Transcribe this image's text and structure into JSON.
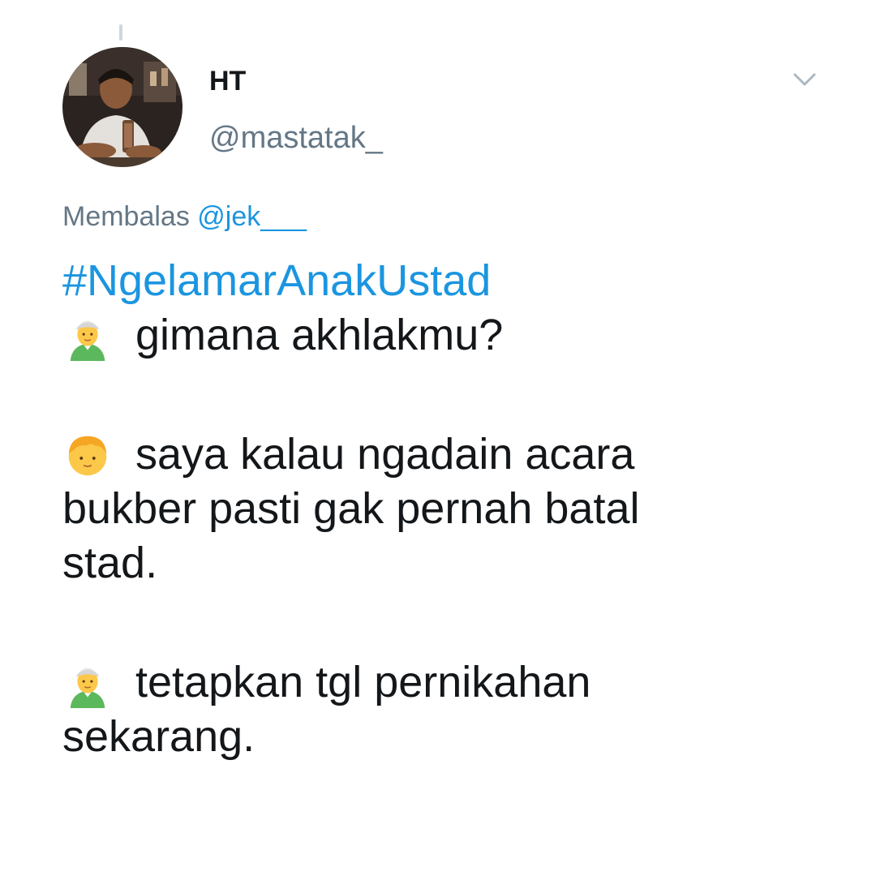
{
  "tweet": {
    "author": {
      "display_name": "HT",
      "handle": "@mastatak_"
    },
    "reply_to": {
      "prefix": "Membalas",
      "mention": "@jek___"
    },
    "hashtag": "#NgelamarAnakUstad",
    "lines": {
      "l1": "gimana akhlakmu?",
      "l2a": "saya kalau ngadain acara",
      "l2b": "bukber pasti gak pernah batal",
      "l2c": "stad.",
      "l3a": "tetapkan tgl pernikahan",
      "l3b": "sekarang."
    },
    "icons": {
      "more": "chevron-down-icon",
      "speaker_ustad": "man-with-turban-emoji",
      "speaker_suitor": "boy-face-emoji"
    }
  },
  "colors": {
    "link": "#1b95e0",
    "secondary_text": "#657786",
    "primary_text": "#14171a"
  }
}
